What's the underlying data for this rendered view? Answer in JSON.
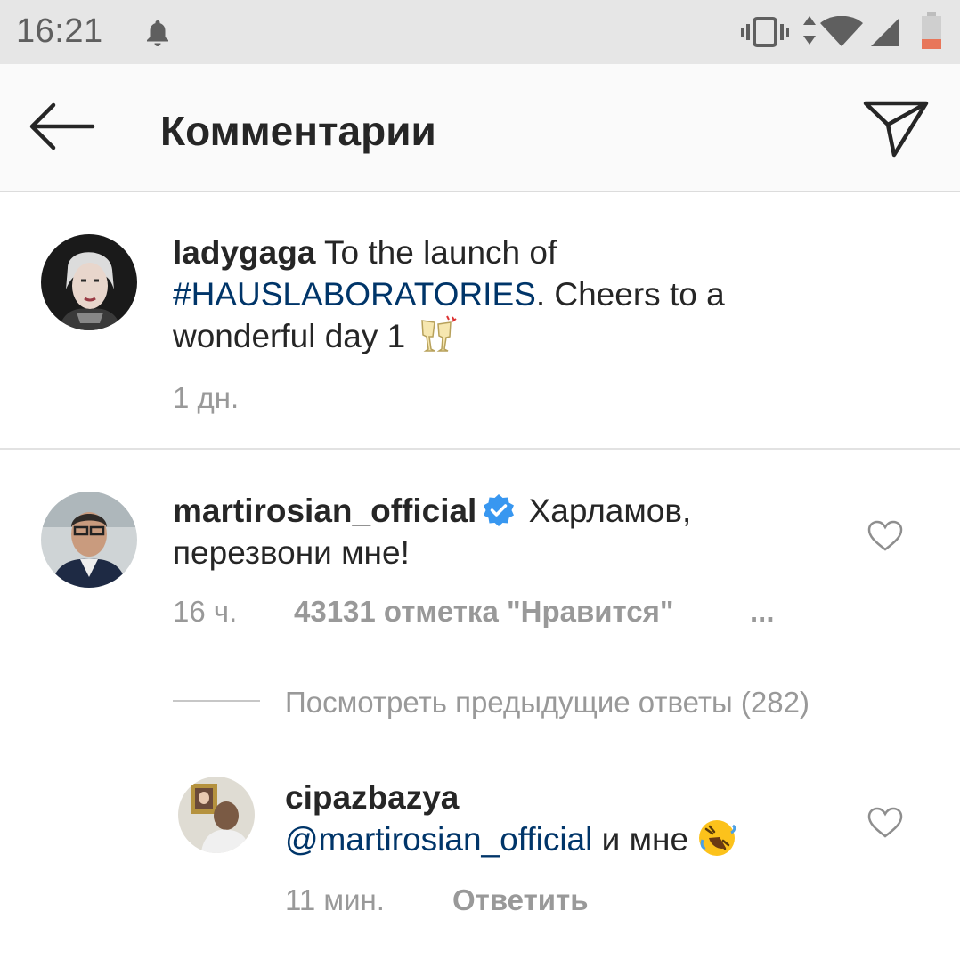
{
  "status_bar": {
    "time": "16:21",
    "icons": [
      "notification-bell-icon",
      "vibrate-icon",
      "data-arrows-icon",
      "wifi-icon",
      "cell-signal-icon",
      "battery-icon"
    ]
  },
  "app_bar": {
    "title": "Комментарии",
    "back_icon": "arrow-left-icon",
    "send_icon": "paper-plane-icon"
  },
  "caption": {
    "username": "ladygaga",
    "text_before": " To the launch of ",
    "hashtag": "#HAUSLABORATORIES",
    "text_after": ". Cheers to a wonderful day 1 ",
    "emoji": "🥂",
    "time": "1 дн."
  },
  "comment": {
    "username": "martirosian_official",
    "verified": true,
    "text": " Харламов, перезвони мне!",
    "time": "16 ч.",
    "likes": "43131 отметка \"Нравится\"",
    "more": "...",
    "view_replies": "Посмотреть предыдущие ответы (282)"
  },
  "reply": {
    "username": "cipazbazya",
    "mention": "@martirosian_official",
    "text": " и мне ",
    "emoji": "🤣",
    "time": "11 мин.",
    "reply_label": "Ответить"
  },
  "colors": {
    "link": "#003569",
    "secondary_text": "#999999",
    "verified_badge": "#3897f0",
    "status_bar_bg": "#e6e6e6",
    "battery_low": "#e8765a"
  }
}
